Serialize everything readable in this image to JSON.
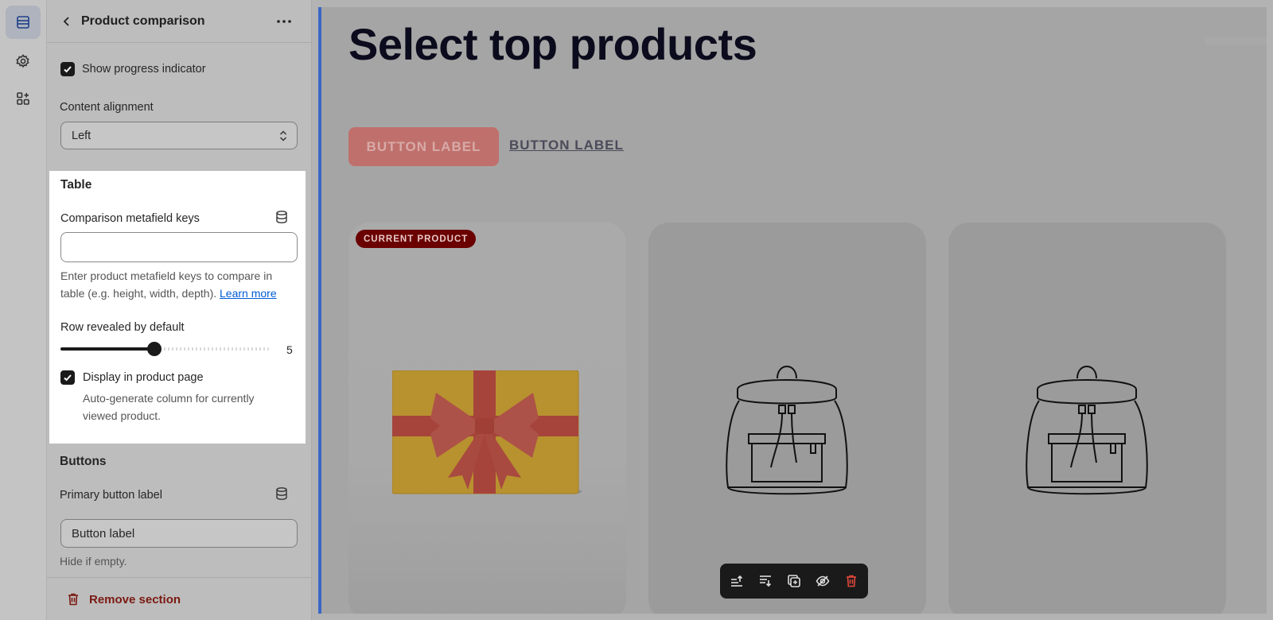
{
  "rail": {
    "items": [
      {
        "icon": "sections-icon",
        "active": true
      },
      {
        "icon": "gear-icon",
        "active": false
      },
      {
        "icon": "apps-icon",
        "active": false
      }
    ]
  },
  "panel": {
    "title": "Product comparison",
    "show_progress_label": "Show progress indicator",
    "show_progress_checked": true,
    "content_alignment_label": "Content alignment",
    "content_alignment_value": "Left",
    "table": {
      "heading": "Table",
      "metafield_label": "Comparison metafield keys",
      "metafield_value": "",
      "metafield_help_1": "Enter product metafield keys to compare in",
      "metafield_help_2": "table (e.g. height, width, depth).",
      "learn_more": "Learn more",
      "rows_label": "Row revealed by default",
      "rows_value": "5",
      "rows_fraction": 0.45,
      "display_label": "Display in product page",
      "display_checked": true,
      "display_help_1": "Auto-generate column for currently",
      "display_help_2": "viewed product."
    },
    "buttons": {
      "heading": "Buttons",
      "primary_label": "Primary button label",
      "primary_value": "Button label",
      "primary_help": "Hide if empty."
    },
    "remove_label": "Remove section"
  },
  "preview": {
    "heading": "Select top products",
    "primary_button": "BUTTON LABEL",
    "secondary_button": "BUTTON LABEL",
    "badge": "CURRENT PRODUCT",
    "accent": "#3a66c6",
    "toolbar_icons": [
      "move-up-icon",
      "move-down-icon",
      "duplicate-icon",
      "hide-icon",
      "delete-icon"
    ]
  }
}
